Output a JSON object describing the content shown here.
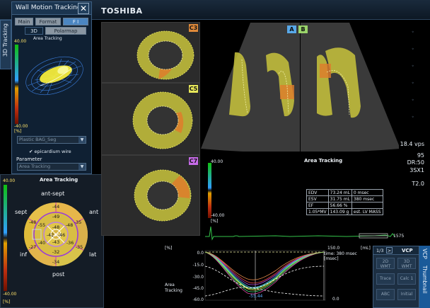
{
  "topbar": {
    "brand": "TOSHIBA"
  },
  "left_tab": {
    "label": "3D Tracking"
  },
  "wall_motion": {
    "title": "Wall Motion Tracking",
    "close": "✕",
    "tabs": {
      "main": "Main",
      "format": "Format",
      "f": "F I",
      "three_d": "3D",
      "polarmap": "Polarmap"
    },
    "subtitle": "Area Tracking",
    "scale_top": "40.00",
    "scale_bottom": "-40.00",
    "scale_unit": "[%]",
    "seg_select": "Plastic BAG_Seg",
    "epicardium_label": "epicardium wire",
    "parameter_label": "Parameter",
    "parameter_select": "Area Tracking"
  },
  "bullseye": {
    "title": "Area Tracking",
    "scale_top": "40.00",
    "scale_bottom": "-40.00",
    "scale_unit": "[%]",
    "labels": {
      "ant_sept": "ant-sept",
      "sept": "sept",
      "ant": "ant",
      "inf": "inf",
      "lat": "lat",
      "post": "post"
    },
    "values": {
      "outer": [
        "-44",
        "-35",
        "-35",
        "-34",
        "-27",
        "-48"
      ],
      "mid": [
        "-49",
        "-48",
        "-36",
        "-32",
        "-40",
        "-55"
      ],
      "inner": [
        "-48",
        "-46",
        "-43",
        "-42"
      ],
      "apex": "-40"
    }
  },
  "images": {
    "short_axis": [
      {
        "tag": "C3",
        "color": "#e08a3a"
      },
      {
        "tag": "C5",
        "color": "#e8e85a"
      },
      {
        "tag": "C7",
        "color": "#c76be8"
      }
    ],
    "apical": [
      {
        "tag": "A",
        "color": "#58a8e8"
      },
      {
        "tag": "B",
        "color": "#9ad46a"
      }
    ]
  },
  "readouts": {
    "fps": "18.4 vps",
    "num": "95",
    "dr": "DR:50",
    "probe": "3SX1",
    "t": "T2.0"
  },
  "area_tracking": {
    "title": "Area Tracking",
    "scale_top": "40.00",
    "scale_bottom": "-40.00",
    "scale_unit": "[%]"
  },
  "values_table": [
    [
      "EDV",
      "73.24 mL",
      "0 msec"
    ],
    [
      "ESV",
      "31.75 mL",
      "380 msec"
    ],
    [
      "EF",
      "56.66 %",
      ""
    ],
    [
      "1.05*MV",
      "143.09 g",
      "est. LV MASS"
    ]
  ],
  "ecg": {
    "hr": "1575"
  },
  "graph": {
    "y_unit": "[%]",
    "ml_unit": "[mL]",
    "y_ticks": [
      "0.0",
      "-15.0",
      "-30.0",
      "-45.0",
      "-60.0"
    ],
    "ml_top": "150.0",
    "ml_bottom": "0.0",
    "time_label": "time: 380 msec",
    "time_unit": "[msec]",
    "side_label": "Area Tracking",
    "cursor_value": "-55.44"
  },
  "vcp": {
    "page": "1/3",
    "next": ">",
    "title": "VCP",
    "side": "VCP",
    "side2": "Thumbnail",
    "buttons": [
      {
        "line1": "2D",
        "line2": "WMT"
      },
      {
        "line1": "3D",
        "line2": "WMT"
      },
      {
        "line1": "Trace",
        "line2": ""
      },
      {
        "line1": "Calc 1",
        "line2": ""
      },
      {
        "line1": "ABC",
        "line2": ""
      },
      {
        "line1": "Initial",
        "line2": ""
      }
    ]
  },
  "colors": {
    "myocardium": "#d8d04a",
    "myocardium_warm": "#e0782c",
    "panel_bg": "#0f2033"
  }
}
